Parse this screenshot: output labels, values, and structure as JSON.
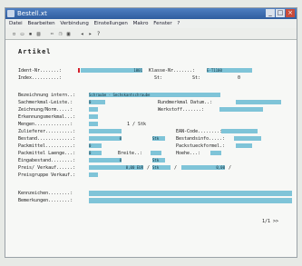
{
  "window": {
    "title": "Bestell.xt"
  },
  "menu": [
    "Datei",
    "Bearbeiten",
    "Verbindung",
    "Einstellungen",
    "Makro",
    "Fenster",
    "?"
  ],
  "toolbar_icons": [
    "new-icon",
    "open-icon",
    "save-icon",
    "print-icon",
    "cut-icon",
    "copy-icon",
    "paste-icon",
    "back-icon",
    "forward-icon",
    "help-icon"
  ],
  "form": {
    "heading": "Artikel",
    "labels": {
      "ident": "Ident-Nr.......:",
      "klasse": "Klasse-Nr.......:",
      "index": "Index..........:",
      "bezeichnung": "Bezeichnung intern..:",
      "sachmerkmal": "Sachmerkmal-Leiste.:",
      "rundmerkmal": "Rundmerkmal Datum..:",
      "zeichnung": "Zeichnung/Norm.....:",
      "werkstoff": "Werkstoff.......:",
      "erkennung": "Erkennungsmerkmal...:",
      "menge": "Mengen.............:",
      "zulieferer": "Zulieferer..........:",
      "eanc": "EAN-Code........:",
      "bestand": "Bestand.............:",
      "bestandsinfo": "Bestandsinfo.....:",
      "packmittel": "Packmittel..........:",
      "packstueck": "Packstueckformel.:",
      "packlaenge": "Packmittel Laenge...:",
      "breite": "Breite..:",
      "hoehe": "Hoehe...:",
      "eingabe": "Eingabestand........:",
      "preis": "Preis/ Verkauf......:",
      "preisgruppe": "Preisgruppe Verkauf.:",
      "kennzeichen": "Kennzeichen........:",
      "bemerkungen": "Bemerkungen........:"
    },
    "values": {
      "ident": "1001",
      "klasse": "E-T1100",
      "status_mid": "St:",
      "status_right": "St:",
      "bezeichnung": "Schraube - Sechskantschraube",
      "sachmerkmal": "0",
      "menge": "1 / Stk",
      "bestand": "0",
      "bestand_unit": "Stk",
      "packmittel": "0",
      "packlaenge": "0",
      "eingabe": "0",
      "eingabe_unit": "Stk",
      "preis": "0,00 EUR",
      "preis_unit": "Stk",
      "preis2": "0,00"
    },
    "status_text": "1/1 >>"
  }
}
